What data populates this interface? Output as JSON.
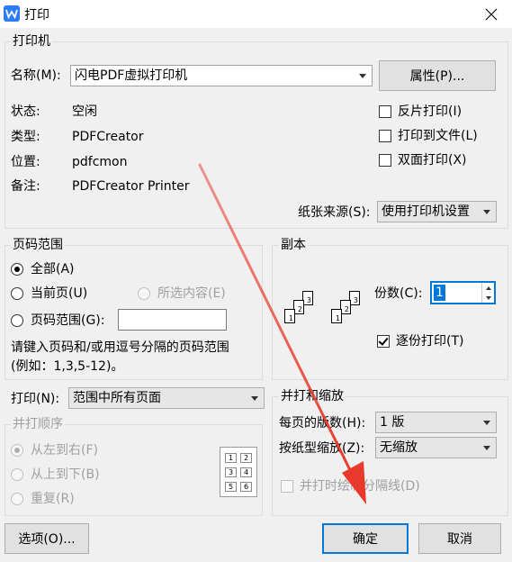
{
  "window": {
    "title": "打印"
  },
  "printer": {
    "group_label": "打印机",
    "name_label": "名称(M):",
    "name_value": "闪电PDF虚拟打印机",
    "properties_button": "属性(P)...",
    "status_label": "状态:",
    "status_value": "空闲",
    "type_label": "类型:",
    "type_value": "PDFCreator",
    "location_label": "位置:",
    "location_value": "pdfcmon",
    "comment_label": "备注:",
    "comment_value": "PDFCreator Printer",
    "reverse_print": "反片打印(I)",
    "print_to_file": "打印到文件(L)",
    "duplex_print": "双面打印(X)",
    "paper_source_label": "纸张来源(S):",
    "paper_source_value": "使用打印机设置"
  },
  "page_range": {
    "group_label": "页码范围",
    "all": "全部(A)",
    "current_page": "当前页(U)",
    "selection": "所选内容(E)",
    "pages": "页码范围(G):",
    "hint_line1": "请键入页码和/或用逗号分隔的页码范围",
    "hint_line2": "(例如：1,3,5-12)。"
  },
  "copies": {
    "group_label": "副本",
    "count_label": "份数(C):",
    "count_value": "1",
    "collate": "逐份打印(T)"
  },
  "print_what": {
    "label": "打印(N):",
    "value": "范围中所有页面"
  },
  "order": {
    "group_label": "并打顺序",
    "left_to_right": "从左到右(F)",
    "top_to_bottom": "从上到下(B)",
    "repeat": "重复(R)",
    "preview_numbers": [
      "1",
      "2",
      "3",
      "4",
      "5",
      "6"
    ]
  },
  "zoom": {
    "group_label": "并打和缩放",
    "pages_per_sheet_label": "每页的版数(H):",
    "pages_per_sheet_value": "1 版",
    "scale_to_paper_label": "按纸型缩放(Z):",
    "scale_to_paper_value": "无缩放",
    "draw_borders": "并打时绘制分隔线(D)"
  },
  "buttons": {
    "options": "选项(O)...",
    "ok": "确定",
    "cancel": "取消"
  },
  "colors": {
    "accent": "#0078d7",
    "annotation_arrow": "#e8392c"
  },
  "icons": {
    "app": "wps-writer-icon",
    "close": "close-icon"
  }
}
